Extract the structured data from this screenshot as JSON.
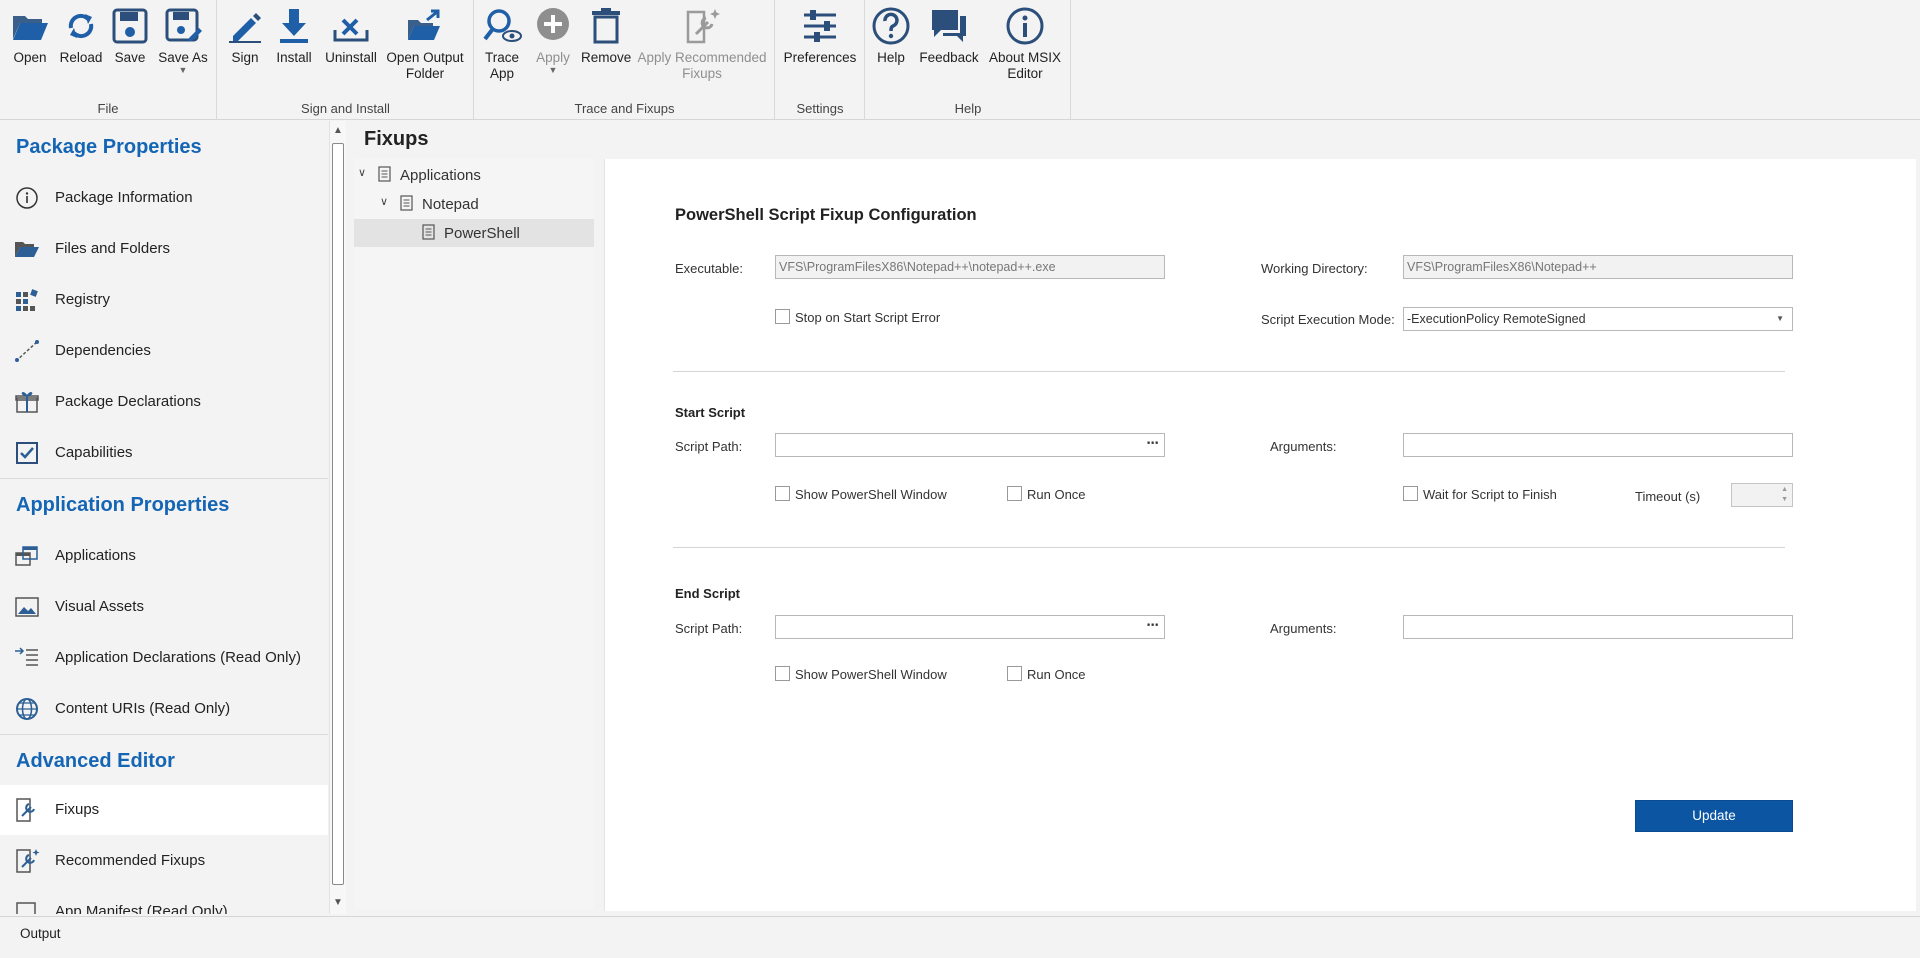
{
  "ribbon": {
    "groups": {
      "file": "File",
      "sign_install": "Sign and Install",
      "trace_fixups": "Trace and Fixups",
      "settings": "Settings",
      "help": "Help"
    },
    "buttons": {
      "open": "Open",
      "reload": "Reload",
      "save": "Save",
      "save_as": "Save As",
      "sign": "Sign",
      "install": "Install",
      "uninstall": "Uninstall",
      "open_output_1": "Open Output",
      "open_output_2": "Folder",
      "trace_1": "Trace",
      "trace_2": "App",
      "apply": "Apply",
      "remove": "Remove",
      "apply_rec_1": "Apply Recommended",
      "apply_rec_2": "Fixups",
      "preferences": "Preferences",
      "help": "Help",
      "feedback": "Feedback",
      "about_1": "About MSIX",
      "about_2": "Editor"
    }
  },
  "sidebar": {
    "package_properties": "Package Properties",
    "application_properties": "Application Properties",
    "advanced_editor": "Advanced Editor",
    "items": {
      "package_information": "Package Information",
      "files_and_folders": "Files and Folders",
      "registry": "Registry",
      "dependencies": "Dependencies",
      "package_declarations": "Package Declarations",
      "capabilities": "Capabilities",
      "applications": "Applications",
      "visual_assets": "Visual Assets",
      "application_declarations": "Application Declarations (Read Only)",
      "content_uris": "Content URIs (Read Only)",
      "fixups": "Fixups",
      "recommended_fixups": "Recommended Fixups",
      "app_manifest": "App Manifest (Read Only)"
    }
  },
  "main": {
    "title": "Fixups",
    "tree": {
      "applications": "Applications",
      "notepad": "Notepad",
      "powershell": "PowerShell"
    },
    "config": {
      "heading": "PowerShell Script Fixup Configuration",
      "executable_label": "Executable:",
      "executable_value": "VFS\\ProgramFilesX86\\Notepad++\\notepad++.exe",
      "working_dir_label": "Working Directory:",
      "working_dir_value": "VFS\\ProgramFilesX86\\Notepad++",
      "stop_on_error": "Stop on Start Script Error",
      "exec_mode_label": "Script Execution Mode:",
      "exec_mode_value": "-ExecutionPolicy RemoteSigned",
      "start_script": "Start Script",
      "end_script": "End Script",
      "script_path_label": "Script Path:",
      "arguments_label": "Arguments:",
      "show_window": "Show PowerShell Window",
      "run_once": "Run Once",
      "wait_finish": "Wait for Script to Finish",
      "timeout_label": "Timeout (s)",
      "update": "Update"
    }
  },
  "status": {
    "output": "Output"
  },
  "colors": {
    "accent": "#1565b5",
    "update_button": "#0b55a3"
  }
}
